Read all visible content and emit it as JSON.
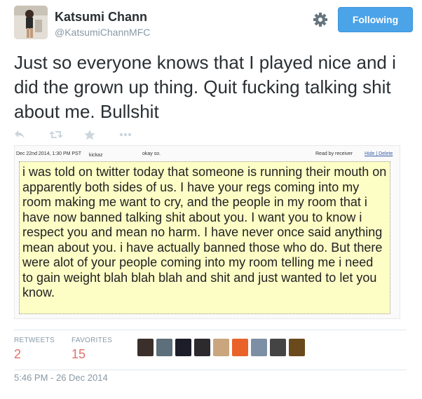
{
  "user": {
    "display_name": "Katsumi Chann",
    "screen_name": "@KatsumiChannMFC",
    "follow_label": "Following"
  },
  "tweet": {
    "text": "Just so everyone knows that I played nice and i did the grown up thing. Quit fucking talking shit about me. Bullshit"
  },
  "actions": [
    {
      "name": "reply-icon"
    },
    {
      "name": "retweet-icon"
    },
    {
      "name": "favorite-icon"
    },
    {
      "name": "more-icon"
    }
  ],
  "attachment": {
    "date": "Dec 22nd 2014, 1:30 PM PST",
    "user": "kickaz",
    "status": "okay so.",
    "read": "Read by receiver",
    "links": "Hide | Delete",
    "message": "i was told on twitter today that someone is running their mouth on apparently both sides of us. I have your regs coming into my room making me want to cry, and the people in my room that i have now banned talking shit about you. I want you to know i respect you and mean no harm. I have never once said anything mean about you. i have actually banned those who do. But there were alot of your people coming into my room telling me i need to gain weight blah blah blah and shit and just wanted to let you know."
  },
  "stats": {
    "retweets_label": "RETWEETS",
    "retweets": "2",
    "favorites_label": "FAVORITES",
    "favorites": "15"
  },
  "favoriters": [
    {
      "color": "#3a2f2a"
    },
    {
      "color": "#5c6f7a"
    },
    {
      "color": "#1d1d2a"
    },
    {
      "color": "#2d2a2e"
    },
    {
      "color": "#c9a67e"
    },
    {
      "color": "#e8622a"
    },
    {
      "color": "#7d8fa4"
    },
    {
      "color": "#444444"
    },
    {
      "color": "#6a4a1c"
    }
  ],
  "timestamp": "5:46 PM - 26 Dec 2014"
}
